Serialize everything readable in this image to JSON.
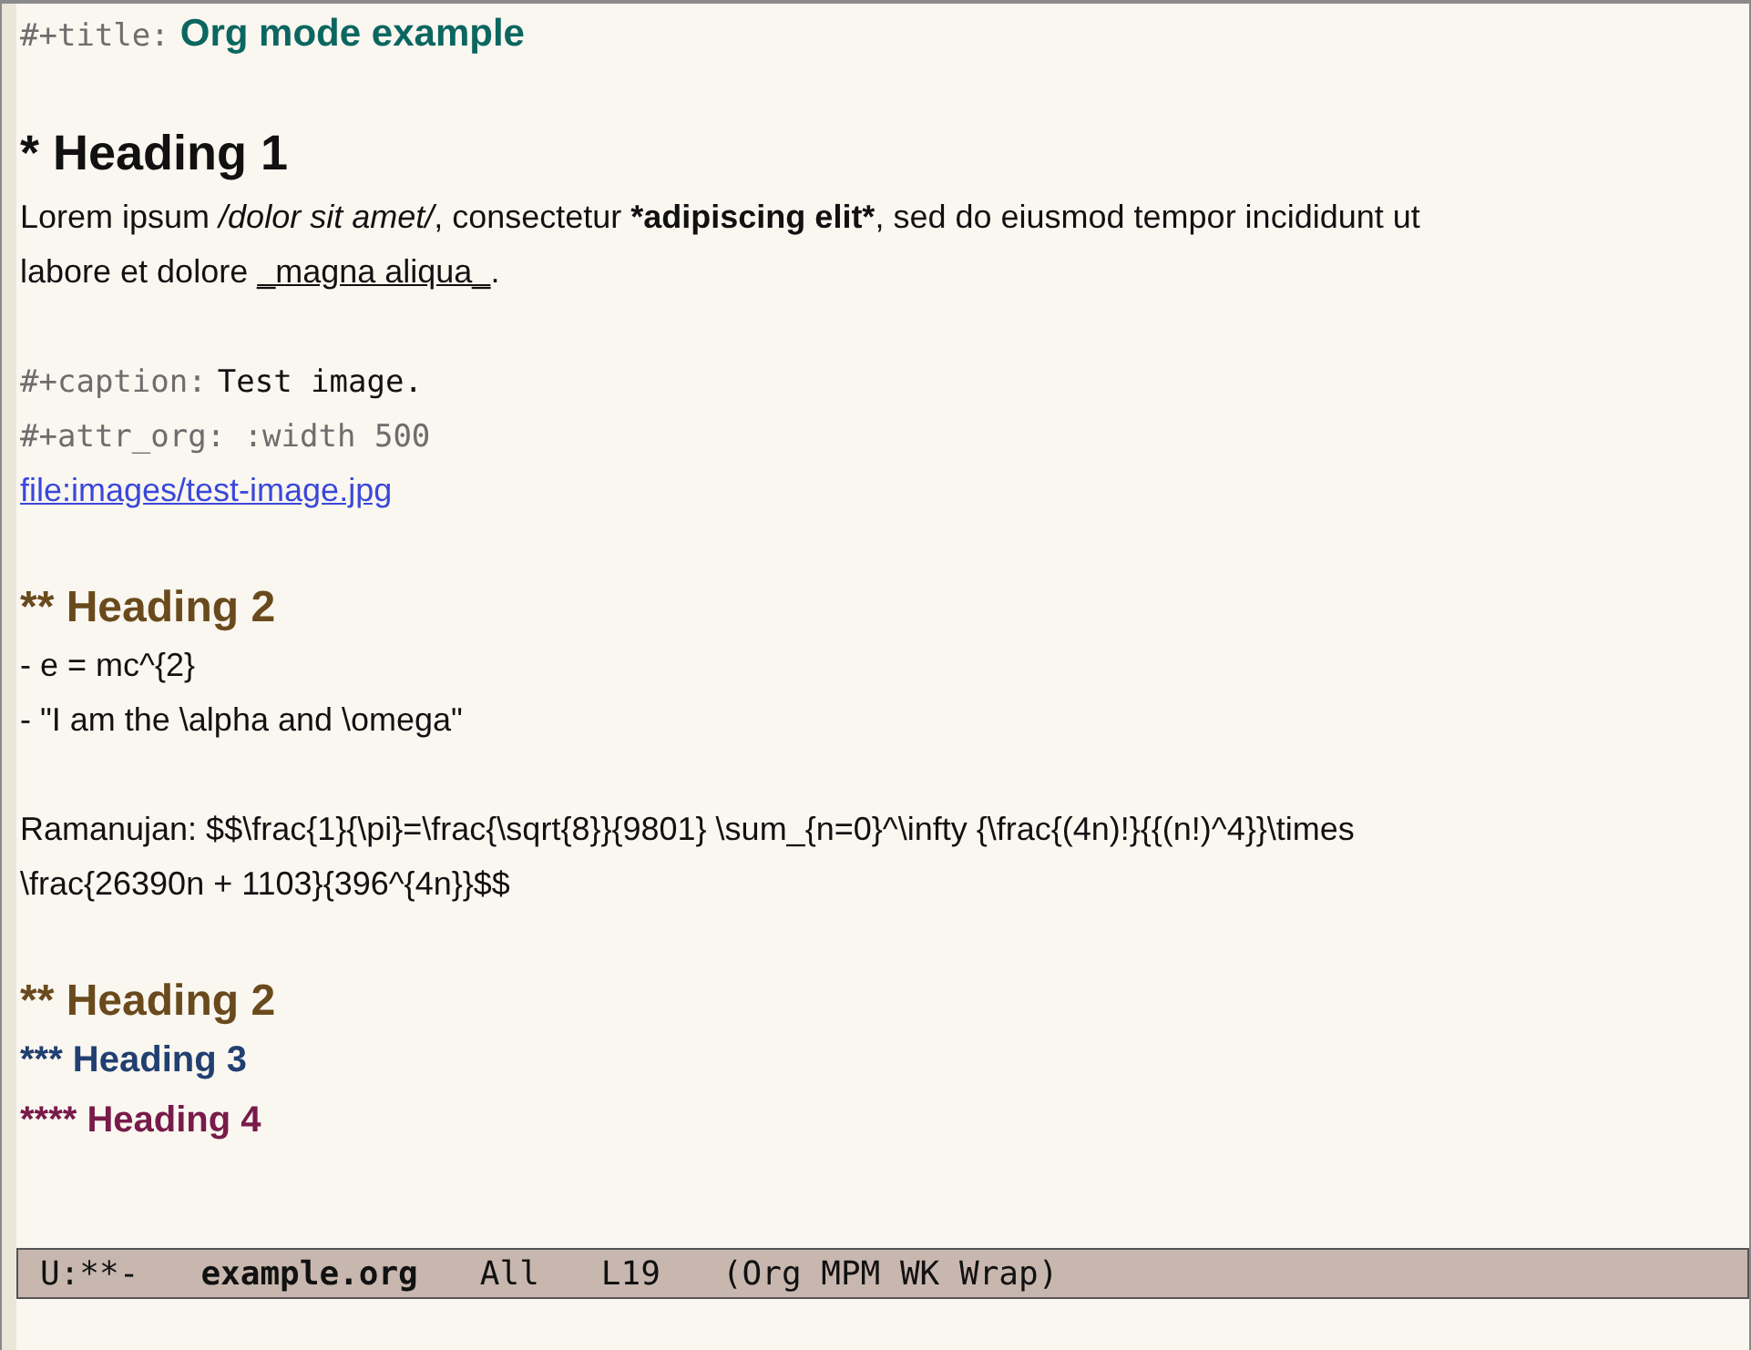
{
  "buffer": {
    "lines": [
      {
        "kind": "keyword",
        "segments": [
          {
            "kind": "meta",
            "text": "#+title:"
          },
          {
            "kind": "title",
            "text": "Org mode example"
          }
        ]
      },
      {
        "kind": "blank"
      },
      {
        "kind": "heading-1",
        "segments": [
          {
            "kind": "plain",
            "text": "* Heading 1"
          }
        ]
      },
      {
        "kind": "text",
        "segments": [
          {
            "kind": "plain",
            "text": "Lorem ipsum "
          },
          {
            "kind": "italic",
            "text": "/dolor sit amet/"
          },
          {
            "kind": "plain",
            "text": ", consectetur "
          },
          {
            "kind": "bold",
            "text": "*adipiscing elit*"
          },
          {
            "kind": "plain",
            "text": ", sed do eiusmod tempor incididunt ut"
          }
        ]
      },
      {
        "kind": "text",
        "segments": [
          {
            "kind": "plain",
            "text": "labore et dolore "
          },
          {
            "kind": "underline",
            "text": "_magna aliqua_"
          },
          {
            "kind": "plain",
            "text": "."
          }
        ]
      },
      {
        "kind": "blank"
      },
      {
        "kind": "keyword",
        "segments": [
          {
            "kind": "meta",
            "text": "#+caption:"
          },
          {
            "kind": "mono",
            "text": "Test image."
          }
        ]
      },
      {
        "kind": "keyword",
        "segments": [
          {
            "kind": "meta",
            "text": "#+attr_org: :width 500"
          }
        ]
      },
      {
        "kind": "link",
        "segments": [
          {
            "kind": "plain",
            "text": "file:images/test-image.jpg"
          }
        ]
      },
      {
        "kind": "blank"
      },
      {
        "kind": "heading-2",
        "segments": [
          {
            "kind": "plain",
            "text": "** Heading 2"
          }
        ]
      },
      {
        "kind": "text",
        "segments": [
          {
            "kind": "plain",
            "text": "- e = mc^{2}"
          }
        ]
      },
      {
        "kind": "text",
        "segments": [
          {
            "kind": "plain",
            "text": "- \"I am the \\alpha and \\omega\""
          }
        ]
      },
      {
        "kind": "blank"
      },
      {
        "kind": "text",
        "segments": [
          {
            "kind": "plain",
            "text": "Ramanujan: $$\\frac{1}{\\pi}=\\frac{\\sqrt{8}}{9801} \\sum_{n=0}^\\infty {\\frac{(4n)!}{{(n!)^4}}\\times"
          }
        ]
      },
      {
        "kind": "text",
        "segments": [
          {
            "kind": "plain",
            "text": "\\frac{26390n + 1103}{396^{4n}}$$"
          }
        ]
      },
      {
        "kind": "blank"
      },
      {
        "kind": "heading-2",
        "segments": [
          {
            "kind": "plain",
            "text": "** Heading 2"
          }
        ]
      },
      {
        "kind": "heading-3",
        "segments": [
          {
            "kind": "plain",
            "text": "*** Heading 3"
          }
        ]
      },
      {
        "kind": "heading-4",
        "segments": [
          {
            "kind": "plain",
            "text": "**** Heading 4"
          }
        ]
      }
    ]
  },
  "mode_line": {
    "status": "U:**-",
    "buffer_name": "example.org",
    "position": "All",
    "line": "L19",
    "modes": "(Org MPM WK Wrap)"
  }
}
